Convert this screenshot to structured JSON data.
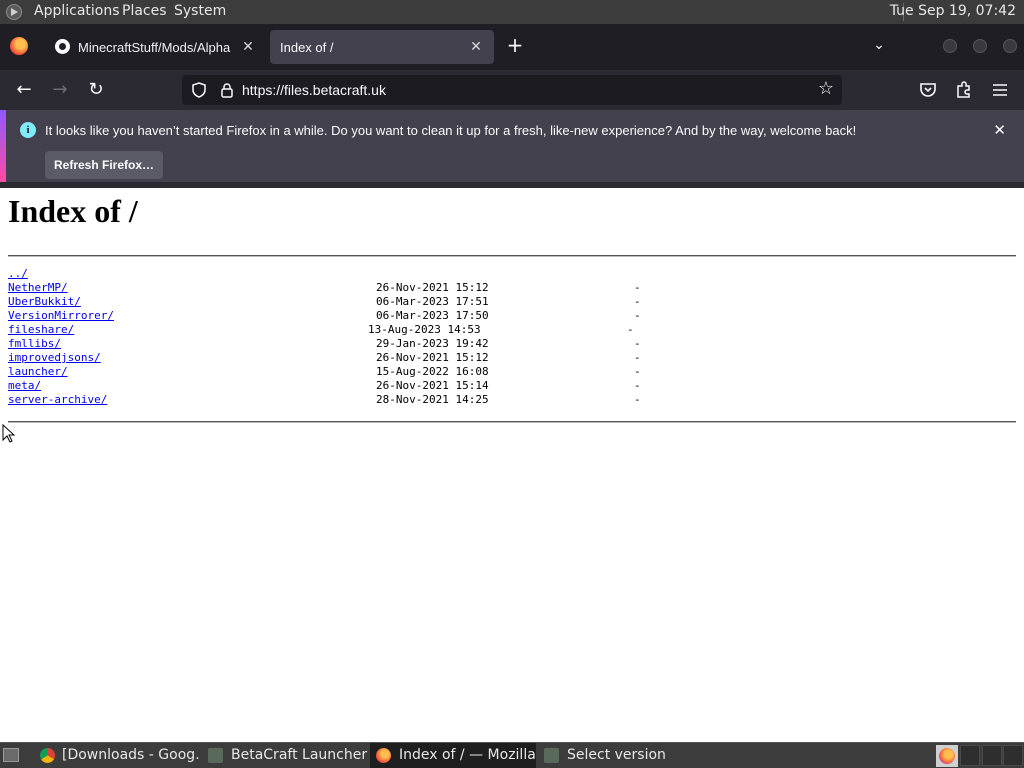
{
  "system_bar": {
    "menus": [
      "Applications",
      "Places",
      "System"
    ],
    "clock": "Tue Sep 19, 07:42"
  },
  "browser": {
    "tabs": [
      {
        "title": "MinecraftStuff/Mods/Alpha",
        "icon": "github-icon",
        "active": false
      },
      {
        "title": "Index of /",
        "icon": "",
        "active": true
      }
    ],
    "url": "https://files.betacraft.uk"
  },
  "notification": {
    "message": "It looks like you haven’t started Firefox in a while. Do you want to clean it up for a fresh, like-new experience? And by the way, welcome back!",
    "button": "Refresh Firefox…",
    "close": "✕"
  },
  "page": {
    "heading": "Index of /",
    "parent_link": "../",
    "entries": [
      {
        "name": "NetherMP/",
        "date": "26-Nov-2021 15:12",
        "size": "-"
      },
      {
        "name": "UberBukkit/",
        "date": "06-Mar-2023 17:51",
        "size": "-"
      },
      {
        "name": "VersionMirrorer/",
        "date": "06-Mar-2023 17:50",
        "size": "-"
      },
      {
        "name": "fileshare/",
        "date": "13-Aug-2023 14:53",
        "size": "-"
      },
      {
        "name": "fmllibs/",
        "date": "29-Jan-2023 19:42",
        "size": "-"
      },
      {
        "name": "improvedjsons/",
        "date": "26-Nov-2021 15:12",
        "size": "-"
      },
      {
        "name": "launcher/",
        "date": "15-Aug-2022 16:08",
        "size": "-"
      },
      {
        "name": "meta/",
        "date": "26-Nov-2021 15:14",
        "size": "-"
      },
      {
        "name": "server-archive/",
        "date": "28-Nov-2021 14:25",
        "size": "-"
      }
    ]
  },
  "taskbar": {
    "tasks": [
      {
        "label": "[Downloads - Goog…",
        "icon": "chrome-icon",
        "active": false
      },
      {
        "label": "BetaCraft Launcher …",
        "icon": "java-icon",
        "active": false
      },
      {
        "label": "Index of / — Mozilla…",
        "icon": "firefox-icon",
        "active": true
      },
      {
        "label": "Select version",
        "icon": "java-icon",
        "active": false
      }
    ]
  }
}
